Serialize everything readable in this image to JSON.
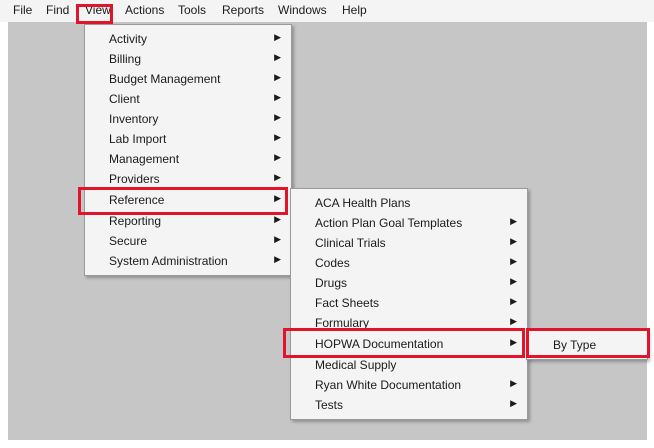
{
  "colors": {
    "highlight": "#e0152b",
    "desktop": "#c6c6c6",
    "menu_bg": "#f4f4f4"
  },
  "menubar": {
    "items": [
      "File",
      "Find",
      "View",
      "Actions",
      "Tools",
      "Reports",
      "Windows",
      "Help"
    ]
  },
  "view_menu": {
    "submenu_icon": "chevron-right-icon",
    "items": [
      "Activity",
      "Billing",
      "Budget Management",
      "Client",
      "Inventory",
      "Lab Import",
      "Management",
      "Providers",
      "Reference",
      "Reporting",
      "Secure",
      "System Administration"
    ],
    "selected": "Reference"
  },
  "reference_menu": {
    "items": [
      "ACA Health Plans",
      "Action Plan Goal Templates",
      "Clinical Trials",
      "Codes",
      "Drugs",
      "Fact Sheets",
      "Formulary",
      "HOPWA Documentation",
      "Medical Supply",
      "Ryan White Documentation",
      "Tests"
    ],
    "selected": "HOPWA Documentation"
  },
  "hopwa_menu": {
    "items": [
      "By Type"
    ]
  }
}
